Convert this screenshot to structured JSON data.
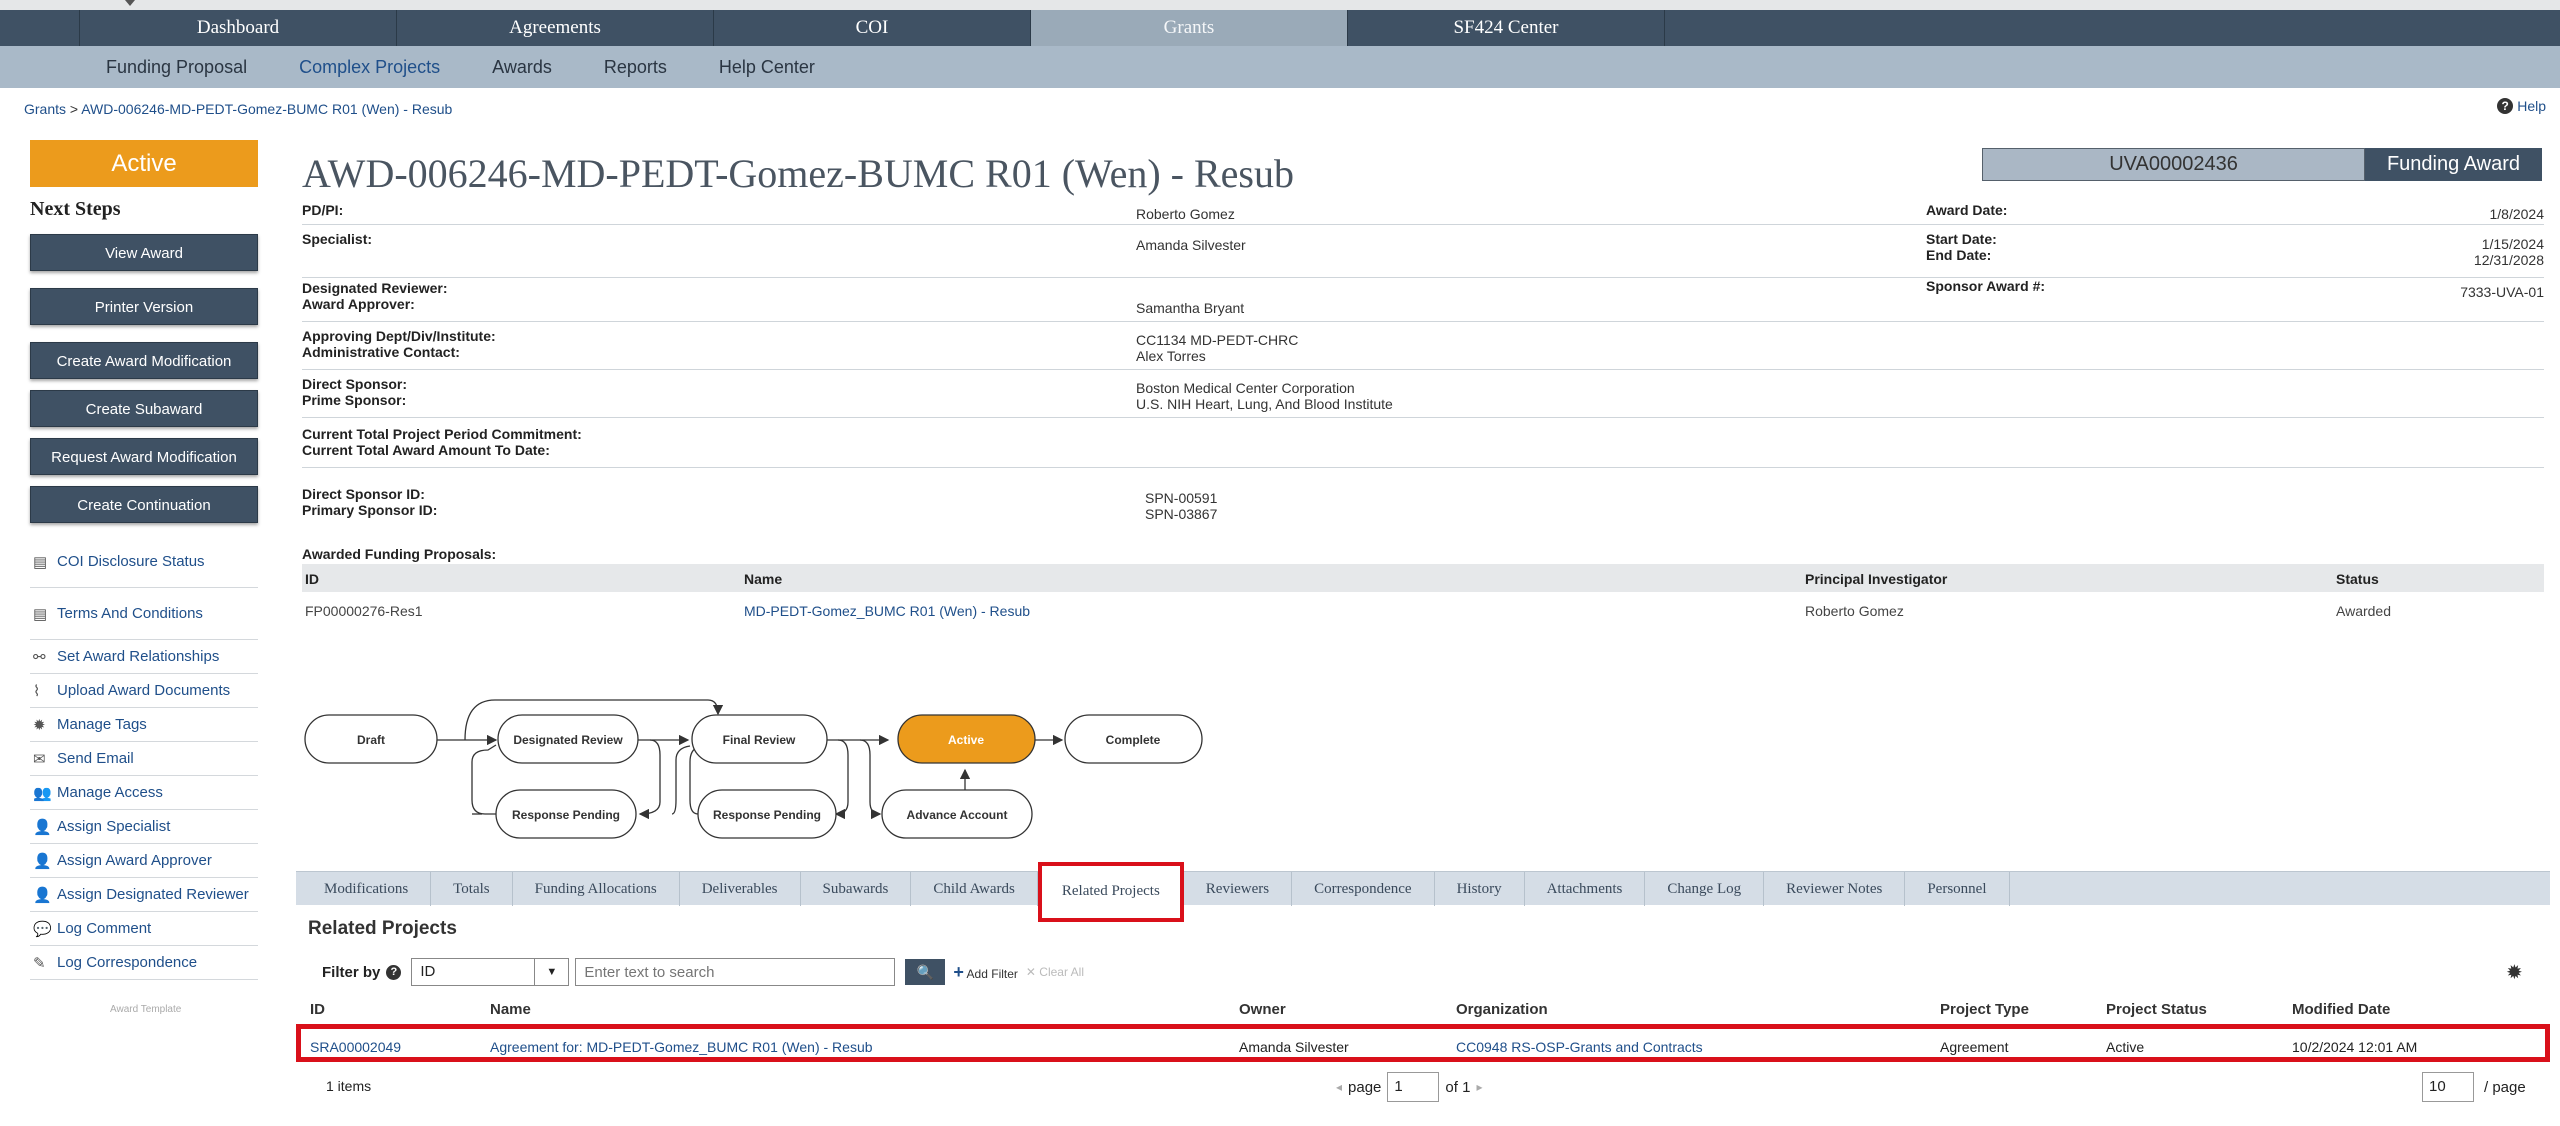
{
  "main_nav": [
    {
      "label": "Dashboard",
      "active": false
    },
    {
      "label": "Agreements",
      "active": false
    },
    {
      "label": "COI",
      "active": false
    },
    {
      "label": "Grants",
      "active": true
    },
    {
      "label": "SF424 Center",
      "active": false
    }
  ],
  "sub_nav": [
    "Funding Proposal",
    "Complex Projects",
    "Awards",
    "Reports",
    "Help Center"
  ],
  "breadcrumb": {
    "root": "Grants",
    "separator": ">",
    "current": "AWD-006246-MD-PEDT-Gomez-BUMC R01 (Wen) - Resub"
  },
  "help_label": "Help",
  "state": "Active",
  "next_steps_title": "Next Steps",
  "action_buttons": [
    "View Award",
    "Printer Version",
    "Create Award Modification",
    "Create Subaward",
    "Request Award Modification",
    "Create Continuation"
  ],
  "side_links": [
    {
      "label": "COI Disclosure Status",
      "icon": "table-icon"
    },
    {
      "label": "Terms And Conditions",
      "icon": "table-icon"
    },
    {
      "label": "Set Award Relationships",
      "icon": "relationship-icon"
    },
    {
      "label": "Upload Award Documents",
      "icon": "paperclip-icon"
    },
    {
      "label": "Manage Tags",
      "icon": "gear-icon"
    },
    {
      "label": "Send Email",
      "icon": "envelope-icon"
    },
    {
      "label": "Manage Access",
      "icon": "users-icon"
    },
    {
      "label": "Assign Specialist",
      "icon": "user-plus-icon"
    },
    {
      "label": "Assign Award Approver",
      "icon": "user-plus-icon"
    },
    {
      "label": "Assign Designated Reviewer",
      "icon": "user-plus-icon"
    },
    {
      "label": "Log Comment",
      "icon": "comment-icon"
    },
    {
      "label": "Log Correspondence",
      "icon": "pencil-icon"
    }
  ],
  "template_note": "Award Template",
  "award": {
    "title": "AWD-006246-MD-PEDT-Gomez-BUMC R01 (Wen) - Resub",
    "id": "UVA00002436",
    "type": "Funding Award",
    "pdpi_label": "PD/PI:",
    "pdpi": "Roberto Gomez",
    "award_date_label": "Award Date:",
    "award_date": "1/8/2024",
    "specialist_label": "Specialist:",
    "specialist": "Amanda Silvester",
    "start_date_label": "Start Date:",
    "start_date": "1/15/2024",
    "end_date_label": "End Date:",
    "end_date": "12/31/2028",
    "designated_reviewer_label": "Designated Reviewer:",
    "award_approver_label": "Award Approver:",
    "award_approver": "Samantha Bryant",
    "sponsor_award_label": "Sponsor Award #:",
    "sponsor_award": "7333-UVA-01",
    "approving_dept_label": "Approving Dept/Div/Institute:",
    "approving_dept": "CC1134 MD-PEDT-CHRC",
    "admin_contact_label": "Administrative Contact:",
    "admin_contact": "Alex Torres",
    "direct_sponsor_label": "Direct Sponsor:",
    "direct_sponsor": "Boston Medical Center Corporation",
    "prime_sponsor_label": "Prime Sponsor:",
    "prime_sponsor": "U.S. NIH Heart, Lung, And Blood Institute",
    "period_commitment_label": "Current Total Project Period Commitment:",
    "award_amount_label": "Current Total Award Amount To Date:",
    "direct_sponsor_id_label": "Direct Sponsor ID:",
    "direct_sponsor_id": "SPN-00591",
    "primary_sponsor_id_label": "Primary Sponsor ID:",
    "primary_sponsor_id": "SPN-03867"
  },
  "funding_proposals": {
    "title": "Awarded Funding Proposals:",
    "columns": [
      "ID",
      "Name",
      "Principal Investigator",
      "Status"
    ],
    "rows": [
      {
        "id": "FP00000276-Res1",
        "name": "MD-PEDT-Gomez_BUMC R01 (Wen) - Resub",
        "pi": "Roberto Gomez",
        "status": "Awarded"
      }
    ]
  },
  "workflow": {
    "states": [
      "Draft",
      "Designated Review",
      "Final Review",
      "Active",
      "Complete",
      "Response Pending",
      "Response Pending",
      "Advance Account"
    ],
    "current": "Active"
  },
  "tabs": [
    "Modifications",
    "Totals",
    "Funding Allocations",
    "Deliverables",
    "Subawards",
    "Child Awards",
    "Related Projects",
    "Reviewers",
    "Correspondence",
    "History",
    "Attachments",
    "Change Log",
    "Reviewer Notes",
    "Personnel"
  ],
  "active_tab": "Related Projects",
  "related_projects": {
    "title": "Related Projects",
    "filter_label": "Filter by",
    "filter_field": "ID",
    "search_placeholder": "Enter text to search",
    "add_filter": "Add Filter",
    "clear_all": "Clear All",
    "columns": [
      "ID",
      "Name",
      "Owner",
      "Organization",
      "Project Type",
      "Project Status",
      "Modified Date"
    ],
    "rows": [
      {
        "id": "SRA00002049",
        "name": "Agreement for: MD-PEDT-Gomez_BUMC R01 (Wen) - Resub",
        "owner": "Amanda Silvester",
        "org": "CC0948 RS-OSP-Grants and Contracts",
        "type": "Agreement",
        "status": "Active",
        "modified": "10/2/2024 12:01 AM"
      }
    ],
    "items_count": "1 items",
    "page_label": "page",
    "page_value": "1",
    "of_label": "of 1",
    "page_size": "10",
    "per_page_label": "/ page"
  },
  "colors": {
    "accent": "#ec9b1c",
    "nav": "#3f5164",
    "highlight": "#d9101a",
    "link": "#1f4f8a"
  }
}
